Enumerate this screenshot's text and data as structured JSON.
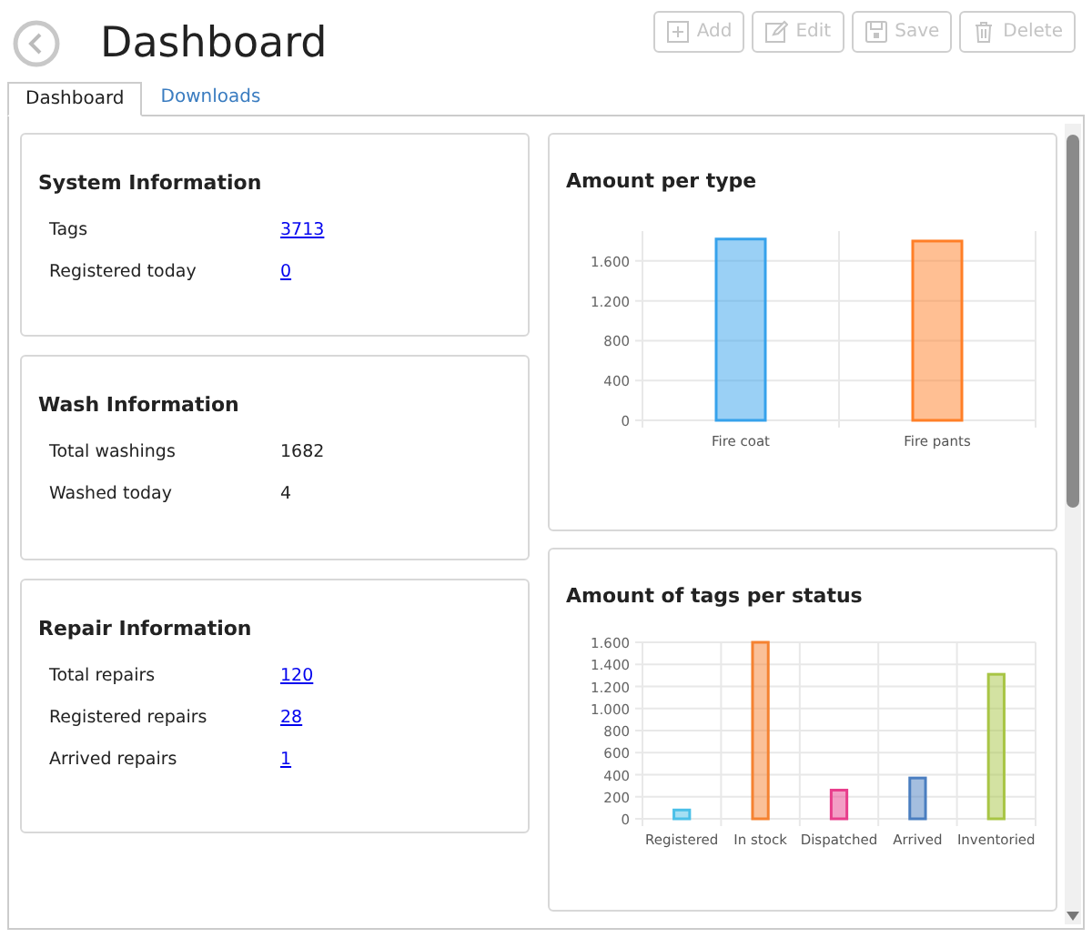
{
  "header": {
    "title": "Dashboard",
    "buttons": [
      {
        "label": "Add",
        "kind": "add",
        "disabled": true
      },
      {
        "label": "Edit",
        "kind": "edit",
        "disabled": true
      },
      {
        "label": "Save",
        "kind": "save",
        "disabled": true
      },
      {
        "label": "Delete",
        "kind": "delete",
        "disabled": true
      }
    ]
  },
  "tabs": [
    {
      "label": "Dashboard",
      "selected": true
    },
    {
      "label": "Downloads",
      "selected": false
    }
  ],
  "info_cards": [
    {
      "title": "System Information",
      "rows": [
        {
          "label": "Tags",
          "value": "3713",
          "link": true
        },
        {
          "label": "Registered today",
          "value": "0",
          "link": true
        }
      ]
    },
    {
      "title": "Wash Information",
      "rows": [
        {
          "label": "Total washings",
          "value": "1682",
          "link": false
        },
        {
          "label": "Washed today",
          "value": "4",
          "link": false
        }
      ]
    },
    {
      "title": "Repair Information",
      "rows": [
        {
          "label": "Total repairs",
          "value": "120",
          "link": true
        },
        {
          "label": "Registered repairs",
          "value": "28",
          "link": true
        },
        {
          "label": "Arrived repairs",
          "value": "1",
          "link": true
        }
      ]
    }
  ],
  "chart_cards": [
    {
      "title": "Amount per type",
      "chart_data": {
        "type": "bar",
        "grid": true,
        "categories": [
          "Fire coat",
          "Fire pants"
        ],
        "ylim": [
          0,
          1900
        ],
        "yticks": [
          0,
          400,
          800,
          {
            "value": 1200,
            "label": "1.200"
          },
          {
            "value": 1600,
            "label": "1.600"
          }
        ],
        "series": [
          {
            "color": "#36a2eb",
            "values": [
              1820,
              null
            ]
          },
          {
            "color": "#ff7f27",
            "values": [
              null,
              1800
            ]
          }
        ]
      }
    },
    {
      "title": "Amount of tags per status",
      "chart_data": {
        "type": "bar",
        "grid": true,
        "categories": [
          "Registered",
          "In stock",
          "Dispatched",
          "Arrived",
          "Inventoried"
        ],
        "ylim": [
          0,
          1600
        ],
        "yticks": [
          0,
          200,
          400,
          600,
          800,
          {
            "value": 1000,
            "label": "1.000"
          },
          {
            "value": 1200,
            "label": "1.200"
          },
          {
            "value": 1400,
            "label": "1.400"
          },
          {
            "value": 1600,
            "label": "1.600"
          }
        ],
        "series": [
          {
            "color": "#4bc0e8",
            "values": [
              80,
              null,
              null,
              null,
              null
            ]
          },
          {
            "color": "#f58231",
            "values": [
              null,
              1600,
              null,
              null,
              null
            ]
          },
          {
            "color": "#e83e8c",
            "values": [
              null,
              null,
              260,
              null,
              null
            ]
          },
          {
            "color": "#4a7ec0",
            "values": [
              null,
              null,
              null,
              370,
              null
            ]
          },
          {
            "color": "#a8c545",
            "values": [
              null,
              null,
              null,
              null,
              1310
            ]
          }
        ]
      }
    }
  ]
}
